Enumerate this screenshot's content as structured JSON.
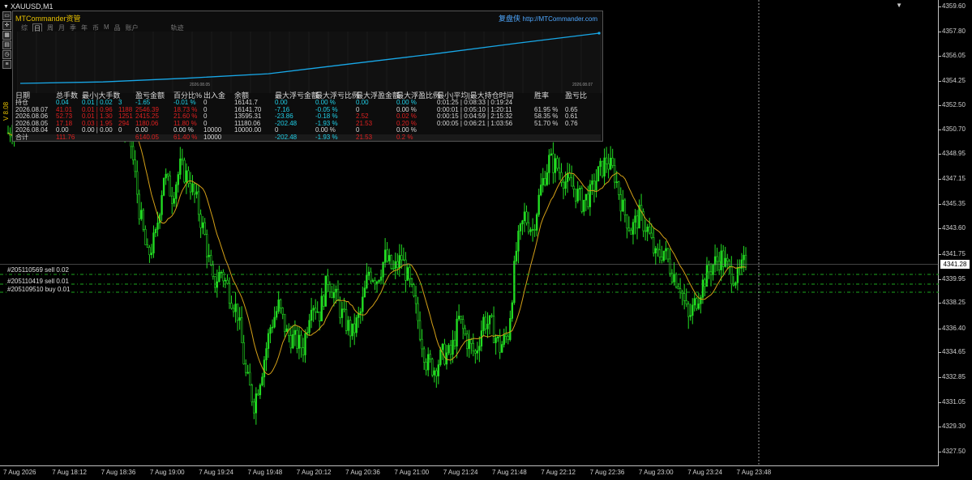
{
  "symbol": "XAUUSD,M1",
  "top_right_marker": "▼",
  "colors": {
    "bull": "#22dd22",
    "ma": "#d4a017",
    "order_line": "#1ea81e",
    "equity_line": "#18a8e8",
    "accent_cyan": "#20d0e8",
    "accent_red": "#e02020",
    "brand": "#e6c000"
  },
  "toolbox_icons": [
    "minimize-icon",
    "cross-icon",
    "grid-icon",
    "chart-icon",
    "timer-icon",
    "list-icon"
  ],
  "toolbox_glyphs": [
    "▭",
    "✛",
    "▦",
    "▤",
    "◷",
    "≡"
  ],
  "vertical_label": "V 8.08",
  "price_axis": {
    "ticks": [
      "4359.60",
      "4357.80",
      "4356.05",
      "4354.25",
      "4352.50",
      "4350.70",
      "4348.95",
      "4347.15",
      "4345.35",
      "4343.60",
      "4341.75",
      "4339.95",
      "4338.25",
      "4336.40",
      "4334.65",
      "4332.85",
      "4331.05",
      "4329.30",
      "4327.50"
    ],
    "current_price": "4341.28"
  },
  "time_axis": {
    "ticks": [
      "7 Aug 2026",
      "7 Aug 18:12",
      "7 Aug 18:36",
      "7 Aug 19:00",
      "7 Aug 19:24",
      "7 Aug 19:48",
      "7 Aug 20:12",
      "7 Aug 20:36",
      "7 Aug 21:00",
      "7 Aug 21:24",
      "7 Aug 21:48",
      "7 Aug 22:12",
      "7 Aug 22:36",
      "7 Aug 23:00",
      "7 Aug 23:24",
      "7 Aug 23:48"
    ]
  },
  "orders": [
    {
      "label": "#205110569 sell 0.02",
      "price": 4340.95
    },
    {
      "label": "#205110419 sell 0.01",
      "price": 4340.3
    },
    {
      "label": "#205109510 buy 0.01",
      "price": 4339.7
    }
  ],
  "panel": {
    "brand": "MTCommander资管",
    "brand_right": "复盘侠",
    "site": "http://MTCommander.com",
    "tabs": [
      "综",
      "日",
      "周",
      "月",
      "季",
      "年",
      "币",
      "M",
      "品",
      "账户",
      "轨迹"
    ],
    "active_tab": 1,
    "equity_x_labels": [
      "2026.08.05",
      "2026.08.07"
    ],
    "equity_curve": [
      10000,
      10180,
      10620,
      11180,
      12400,
      13595,
      14900,
      16141
    ],
    "columns": [
      "日期",
      "总手数",
      "最小|大手数",
      "盈亏金额",
      "百分比%",
      "出入金",
      "余额",
      "最大浮亏金额",
      "最大浮亏比例",
      "最大浮盈金额",
      "最大浮盈比例",
      "最小|平均|最大持仓时间",
      "胜率",
      "盈亏比"
    ],
    "rows": [
      {
        "date": "持仓",
        "lots": "0.04",
        "minmax": "0.01 | 0.02",
        "trades": "3",
        "pnl": "-1.65",
        "pct": "-0.01 %",
        "io": "0",
        "bal": "16141.7",
        "mfl": "0.00",
        "mflp": "0.00 %",
        "mfp": "0.00",
        "mfpp": "0.00 %",
        "time": "0:01:25 | 0:08:33 | 0:19:24",
        "win": "",
        "rr": "",
        "color": "cyan"
      },
      {
        "date": "2026.08.07",
        "lots": "41.01",
        "minmax": "0.01 | 0.96",
        "trades": "1188",
        "pnl": "2546.39",
        "pct": "18.73 %",
        "io": "0",
        "bal": "16141.70",
        "mfl": "-7.16",
        "mflp": "-0.05 %",
        "mfp": "0",
        "mfpp": "0.00 %",
        "time": "0:00:01 | 0:05:10 | 1:20:11",
        "win": "61.95 %",
        "rr": "0.65",
        "color": "red"
      },
      {
        "date": "2026.08.06",
        "lots": "52.73",
        "minmax": "0.01 | 1.30",
        "trades": "1251",
        "pnl": "2415.25",
        "pct": "21.60 %",
        "io": "0",
        "bal": "13595.31",
        "mfl": "-23.86",
        "mflp": "-0.18 %",
        "mfp": "2.52",
        "mfpp": "0.02 %",
        "time": "0:00:15 | 0:04:59 | 2:15:32",
        "win": "58.35 %",
        "rr": "0.61",
        "color": "red"
      },
      {
        "date": "2026.08.05",
        "lots": "17.18",
        "minmax": "0.03 | 1.95",
        "trades": "294",
        "pnl": "1180.06",
        "pct": "11.80 %",
        "io": "0",
        "bal": "11180.06",
        "mfl": "-202.48",
        "mflp": "-1.93 %",
        "mfp": "21.53",
        "mfpp": "0.20 %",
        "time": "0:00:05 | 0:06:21 | 1:03:56",
        "win": "51.70 %",
        "rr": "0.76",
        "color": "red"
      },
      {
        "date": "2026.08.04",
        "lots": "0.00",
        "minmax": "0.00 | 0.00",
        "trades": "0",
        "pnl": "0.00",
        "pct": "0.00 %",
        "io": "10000",
        "bal": "10000.00",
        "mfl": "0",
        "mflp": "0.00 %",
        "mfp": "0",
        "mfpp": "0.00 %",
        "time": "",
        "win": "",
        "rr": "",
        "color": "white"
      }
    ],
    "total": {
      "date": "合计",
      "lots": "111.76",
      "minmax": "",
      "trades": "",
      "pnl": "6140.05",
      "pct": "61.40 %",
      "io": "10000",
      "bal": "",
      "mfl": "-202.48",
      "mflp": "-1.93 %",
      "mfp": "21.53",
      "mfpp": "0.2 %",
      "time": "",
      "win": "",
      "rr": ""
    }
  },
  "chart_data": {
    "type": "candlestick",
    "symbol": "XAUUSD",
    "timeframe": "M1",
    "x_start": "7 Aug 2026 17:48",
    "x_end": "7 Aug 23:59",
    "ylim": [
      4327.0,
      4360.0
    ],
    "close_path": [
      [
        "17:48",
        4350.5
      ],
      [
        "17:55",
        4351.8
      ],
      [
        "18:00",
        4353.2
      ],
      [
        "18:05",
        4352.0
      ],
      [
        "18:10",
        4353.5
      ],
      [
        "18:15",
        4351.5
      ],
      [
        "18:20",
        4353.0
      ],
      [
        "18:25",
        4352.2
      ],
      [
        "18:30",
        4354.0
      ],
      [
        "18:36",
        4352.5
      ],
      [
        "18:42",
        4351.5
      ],
      [
        "18:48",
        4349.6
      ],
      [
        "18:52",
        4345.0
      ],
      [
        "18:56",
        4341.5
      ],
      [
        "19:00",
        4343.0
      ],
      [
        "19:04",
        4347.5
      ],
      [
        "19:08",
        4346.0
      ],
      [
        "19:12",
        4348.0
      ],
      [
        "19:16",
        4347.2
      ],
      [
        "19:20",
        4345.5
      ],
      [
        "19:24",
        4343.0
      ],
      [
        "19:28",
        4339.5
      ],
      [
        "19:32",
        4340.5
      ],
      [
        "19:36",
        4339.0
      ],
      [
        "19:40",
        4337.5
      ],
      [
        "19:44",
        4333.0
      ],
      [
        "19:48",
        4331.0
      ],
      [
        "19:52",
        4333.5
      ],
      [
        "19:56",
        4336.5
      ],
      [
        "20:00",
        4338.0
      ],
      [
        "20:04",
        4336.0
      ],
      [
        "20:08",
        4335.5
      ],
      [
        "20:12",
        4335.0
      ],
      [
        "20:16",
        4338.5
      ],
      [
        "20:20",
        4337.5
      ],
      [
        "20:24",
        4340.0
      ],
      [
        "20:28",
        4338.5
      ],
      [
        "20:32",
        4337.0
      ],
      [
        "20:36",
        4336.0
      ],
      [
        "20:40",
        4337.5
      ],
      [
        "20:44",
        4340.5
      ],
      [
        "20:48",
        4340.0
      ],
      [
        "20:52",
        4341.5
      ],
      [
        "20:56",
        4340.5
      ],
      [
        "21:00",
        4341.5
      ],
      [
        "21:04",
        4339.5
      ],
      [
        "21:08",
        4337.0
      ],
      [
        "21:12",
        4334.0
      ],
      [
        "21:16",
        4333.5
      ],
      [
        "21:20",
        4334.5
      ],
      [
        "21:24",
        4334.5
      ],
      [
        "21:28",
        4337.0
      ],
      [
        "21:32",
        4335.5
      ],
      [
        "21:36",
        4334.5
      ],
      [
        "21:40",
        4337.0
      ],
      [
        "21:44",
        4336.5
      ],
      [
        "21:48",
        4335.0
      ],
      [
        "21:52",
        4336.0
      ],
      [
        "21:56",
        4342.0
      ],
      [
        "22:00",
        4344.5
      ],
      [
        "22:04",
        4343.5
      ],
      [
        "22:08",
        4346.5
      ],
      [
        "22:12",
        4348.5
      ],
      [
        "22:16",
        4348.0
      ],
      [
        "22:20",
        4347.0
      ],
      [
        "22:24",
        4346.5
      ],
      [
        "22:28",
        4345.5
      ],
      [
        "22:32",
        4346.0
      ],
      [
        "22:36",
        4347.5
      ],
      [
        "22:40",
        4348.5
      ],
      [
        "22:44",
        4347.5
      ],
      [
        "22:48",
        4345.0
      ],
      [
        "22:52",
        4343.5
      ],
      [
        "22:56",
        4344.5
      ],
      [
        "23:00",
        4343.5
      ],
      [
        "23:04",
        4341.5
      ],
      [
        "23:08",
        4342.0
      ],
      [
        "23:12",
        4340.5
      ],
      [
        "23:16",
        4339.5
      ],
      [
        "23:20",
        4337.0
      ],
      [
        "23:24",
        4338.5
      ],
      [
        "23:28",
        4340.0
      ],
      [
        "23:32",
        4341.0
      ],
      [
        "23:36",
        4341.5
      ],
      [
        "23:40",
        4340.5
      ],
      [
        "23:44",
        4340.0
      ],
      [
        "23:48",
        4341.3
      ]
    ]
  }
}
